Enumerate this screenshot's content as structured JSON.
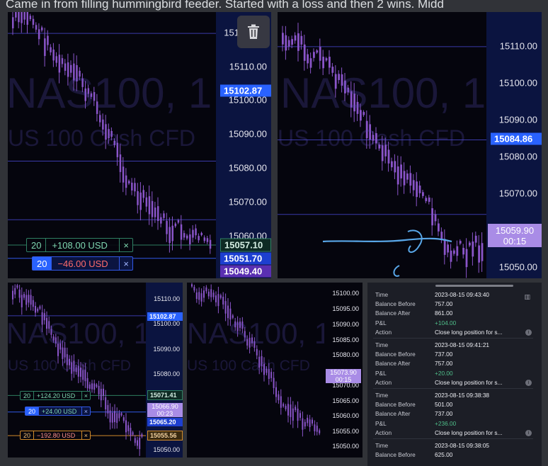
{
  "caption": "Came in from filling hummingbird feeder. Started with a loss and then 2 wins. Midd",
  "theme": {
    "candle": "#8a55c9",
    "axis_bg": "#0c1540",
    "accent_blue": "#2962ff",
    "tag_purple": "#6d3fc8"
  },
  "trash_icon": "trash-icon",
  "panels": [
    {
      "id": "p1",
      "watermark": "NAS100, 1",
      "watermark_sub": "US 100 Cash CFD",
      "axis_labels": [
        "151",
        "15110.00",
        "15100.00",
        "15090.00",
        "15080.00",
        "15070.00",
        "15060.00"
      ],
      "price_tags": [
        {
          "text": "15102.87"
        },
        {
          "text": "15057.10"
        },
        {
          "text": "15051.70"
        },
        {
          "text": "15049.40"
        }
      ],
      "orders": [
        {
          "qty": "20",
          "pnl": "+108.00 USD",
          "close": "×"
        },
        {
          "qty": "20",
          "pnl": "−46.00 USD",
          "close": "×"
        }
      ]
    },
    {
      "id": "p2",
      "watermark": "NAS100, 1",
      "watermark_sub": "US 100 Cash CFD",
      "axis_labels": [
        "15110.00",
        "15100.00",
        "15090.00",
        "15080.00",
        "15070.00",
        "15050.00"
      ],
      "price_tags": [
        {
          "text": "15084.86"
        },
        {
          "text": "15059.90",
          "sub": "00:15"
        }
      ]
    },
    {
      "id": "p3",
      "watermark": "NAS100, 1",
      "watermark_sub": "US 100 Cash CFD",
      "axis_labels": [
        "15110.00",
        "15100.00",
        "15090.00",
        "15080.00",
        "15050.00"
      ],
      "price_tags": [
        {
          "text": "15102.87"
        },
        {
          "text": "15071.41"
        },
        {
          "text": "15066.90",
          "sub": "00:23"
        },
        {
          "text": "15065.20"
        },
        {
          "text": "15055.56"
        }
      ],
      "orders": [
        {
          "qty": "20",
          "pnl": "+124.20 USD",
          "close": "×"
        },
        {
          "qty": "20",
          "pnl": "+24.00 USD",
          "close": "×"
        },
        {
          "qty": "20",
          "pnl": "−192.80 USD",
          "close": "×"
        }
      ]
    },
    {
      "id": "p4",
      "watermark": "NAS100, 1",
      "watermark_sub": "US 100 Cash CFD",
      "axis_labels": [
        "15100.00",
        "15095.00",
        "15090.00",
        "15085.00",
        "15080.00",
        "15070.00",
        "15065.00",
        "15060.00",
        "15055.00",
        "15050.00"
      ],
      "price_tags": [
        {
          "text": "15073.90",
          "sub": "00:15"
        }
      ]
    }
  ],
  "history": {
    "keys": {
      "time": "Time",
      "before": "Balance Before",
      "after": "Balance After",
      "pnl": "P&L",
      "action": "Action"
    },
    "entries": [
      {
        "time": "2023-08-15 09:43:40",
        "before": "757.00",
        "after": "861.00",
        "pnl": "+104.00",
        "action": "Close long position for s..."
      },
      {
        "time": "2023-08-15 09:41:21",
        "before": "737.00",
        "after": "757.00",
        "pnl": "+20.00",
        "action": "Close long position for s..."
      },
      {
        "time": "2023-08-15 09:38:38",
        "before": "501.00",
        "after": "737.00",
        "pnl": "+236.00",
        "action": "Close long position for s..."
      },
      {
        "time": "2023-08-15 09:38:05",
        "before": "625.00"
      }
    ]
  }
}
